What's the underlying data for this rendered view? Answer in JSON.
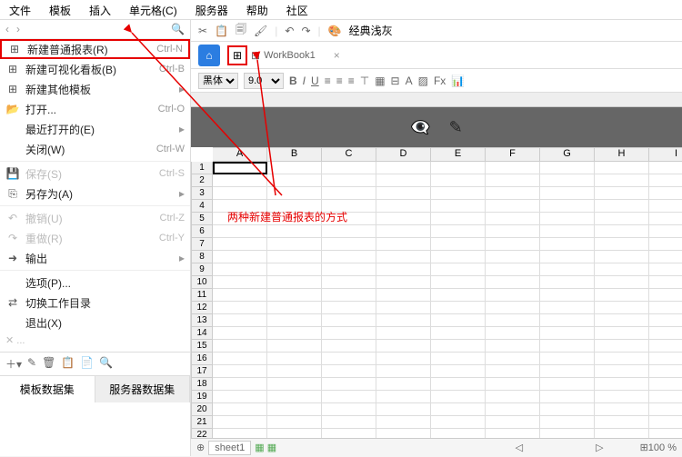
{
  "menu": [
    "文件",
    "模板",
    "插入",
    "单元格(C)",
    "服务器",
    "帮助",
    "社区"
  ],
  "fileMenu": [
    {
      "icon": "⊞",
      "label": "新建普通报表(R)",
      "shortcut": "Ctrl-N",
      "sub": false,
      "dis": false,
      "hl": true
    },
    {
      "icon": "⊞",
      "label": "新建可视化看板(B)",
      "shortcut": "Ctrl-B",
      "sub": false,
      "dis": false
    },
    {
      "icon": "⊞",
      "label": "新建其他模板",
      "shortcut": "",
      "sub": true,
      "dis": false
    },
    {
      "icon": "📂",
      "label": "打开...",
      "shortcut": "Ctrl-O",
      "sub": false,
      "dis": false
    },
    {
      "icon": "",
      "label": "最近打开的(E)",
      "shortcut": "",
      "sub": true,
      "dis": false
    },
    {
      "icon": "",
      "label": "关闭(W)",
      "shortcut": "Ctrl-W",
      "sub": false,
      "dis": false
    },
    {
      "sep": true
    },
    {
      "icon": "💾",
      "label": "保存(S)",
      "shortcut": "Ctrl-S",
      "sub": false,
      "dis": true
    },
    {
      "icon": "⎘",
      "label": "另存为(A)",
      "shortcut": "",
      "sub": true,
      "dis": false
    },
    {
      "sep": true
    },
    {
      "icon": "↶",
      "label": "撤销(U)",
      "shortcut": "Ctrl-Z",
      "sub": false,
      "dis": true
    },
    {
      "icon": "↷",
      "label": "重做(R)",
      "shortcut": "Ctrl-Y",
      "sub": false,
      "dis": true
    },
    {
      "icon": "➜",
      "label": "输出",
      "shortcut": "",
      "sub": true,
      "dis": false
    },
    {
      "sep": true
    },
    {
      "icon": "",
      "label": "选项(P)...",
      "shortcut": "",
      "sub": false,
      "dis": false
    },
    {
      "icon": "⇄",
      "label": "切换工作目录",
      "shortcut": "",
      "sub": false,
      "dis": false
    },
    {
      "icon": "",
      "label": "退出(X)",
      "shortcut": "",
      "sub": false,
      "dis": false
    }
  ],
  "dsTabs": {
    "a": "模板数据集",
    "b": "服务器数据集"
  },
  "topIcons": [
    "✂",
    "📋",
    "🗐",
    "🖌",
    "↶",
    "↷"
  ],
  "theme": "经典浅灰",
  "docTab": "WorkBook1",
  "font": "黑体",
  "fontSize": "9.0",
  "cols": [
    "A",
    "B",
    "C",
    "D",
    "E",
    "F",
    "G",
    "H",
    "I"
  ],
  "rows": [
    "1",
    "2",
    "3",
    "4",
    "5",
    "6",
    "7",
    "8",
    "9",
    "10",
    "11",
    "12",
    "13",
    "14",
    "15",
    "16",
    "17",
    "18",
    "19",
    "20",
    "21",
    "22"
  ],
  "annotation": "两种新建普通报表的方式",
  "sheet": "sheet1",
  "zoom": "100 %"
}
